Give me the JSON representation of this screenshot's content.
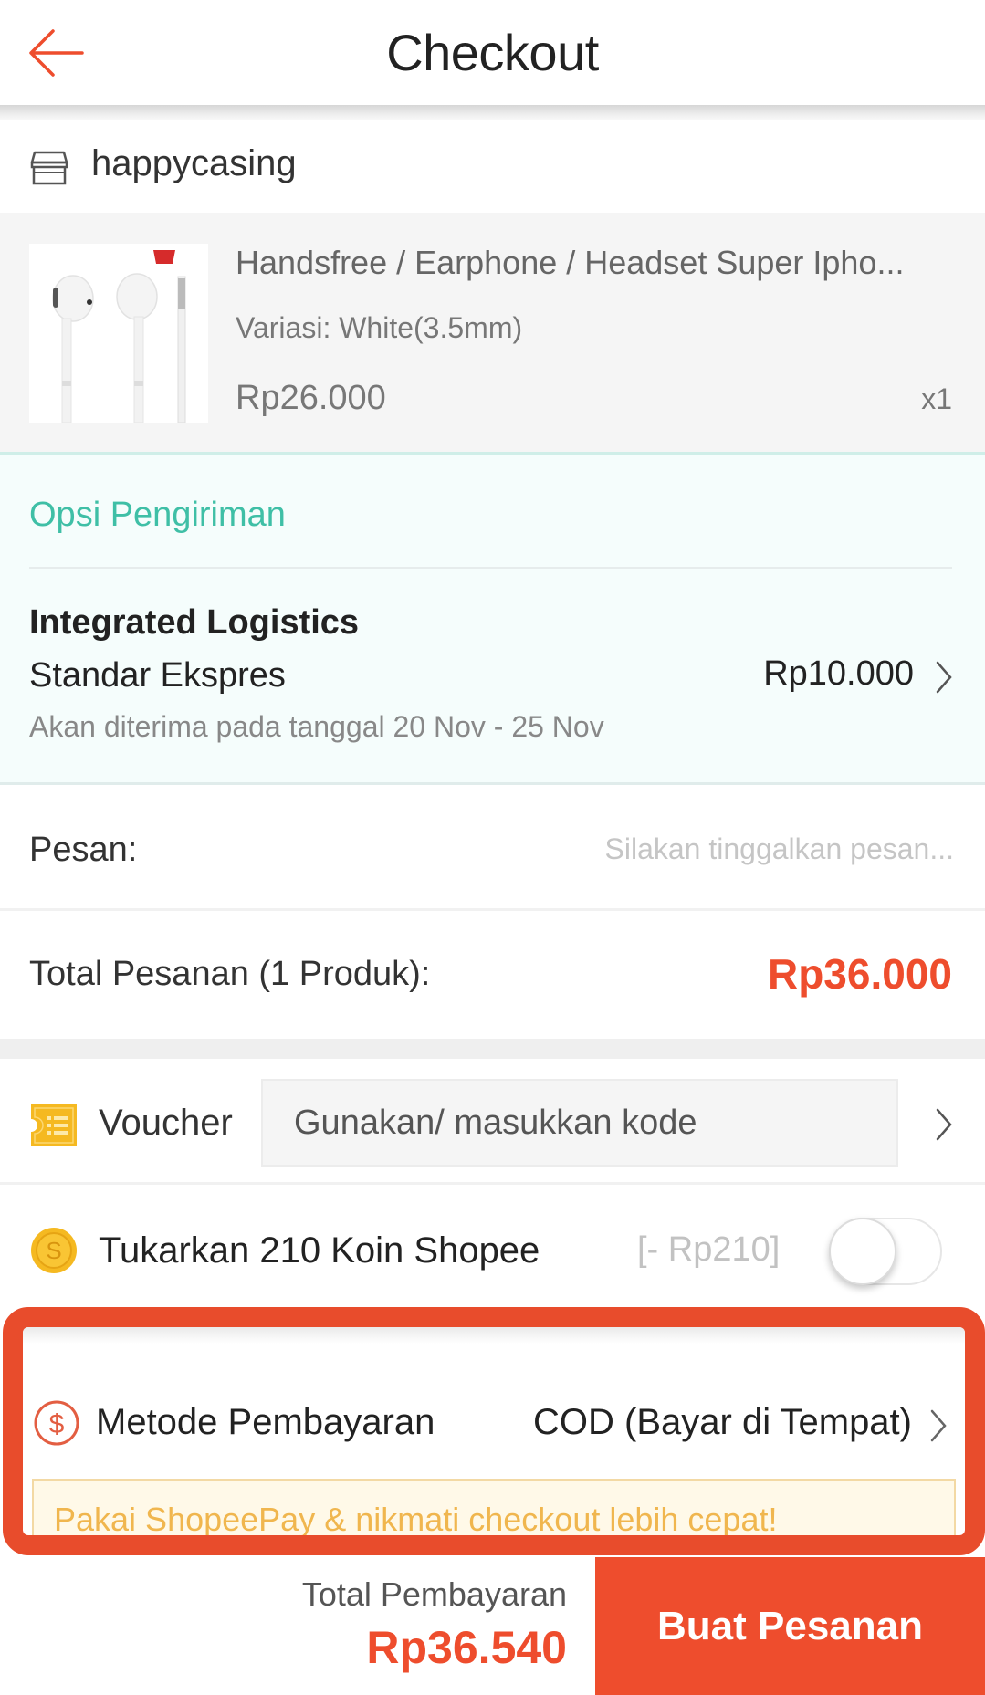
{
  "header": {
    "title": "Checkout",
    "back_icon": "arrow-left-icon",
    "accent_color": "#ee4d2d"
  },
  "shop": {
    "icon": "store-icon",
    "name": "happycasing"
  },
  "product": {
    "image": "white-earphones-image",
    "title": "Handsfree / Earphone / Headset Super Ipho...",
    "variant": "Variasi: White(3.5mm)",
    "price": "Rp26.000",
    "quantity": "x1"
  },
  "shipping": {
    "heading": "Opsi Pengiriman",
    "provider": "Integrated Logistics",
    "service": "Standar Ekspres",
    "price": "Rp10.000",
    "eta": "Akan diterima pada tanggal 20 Nov - 25 Nov",
    "heading_color": "#3fbfa6"
  },
  "message": {
    "label": "Pesan:",
    "placeholder": "Silakan tinggalkan pesan...",
    "value": ""
  },
  "order_total": {
    "label": "Total Pesanan (1 Produk):",
    "value": "Rp36.000"
  },
  "voucher": {
    "icon": "voucher-ticket-icon",
    "label": "Voucher",
    "placeholder": "Gunakan/ masukkan kode"
  },
  "coins": {
    "icon": "shopee-coin-icon",
    "label": "Tukarkan 210 Koin Shopee",
    "amount": "[- Rp210]",
    "toggle_on": false
  },
  "payment": {
    "icon": "dollar-circle-icon",
    "label": "Metode Pembayaran",
    "value": "COD (Bayar di Tempat)",
    "promo": "Pakai ShopeePay & nikmati checkout lebih cepat!",
    "highlight_color": "#e84c2c"
  },
  "footer": {
    "total_label": "Total Pembayaran",
    "total_value": "Rp36.540",
    "place_order_label": "Buat Pesanan"
  }
}
